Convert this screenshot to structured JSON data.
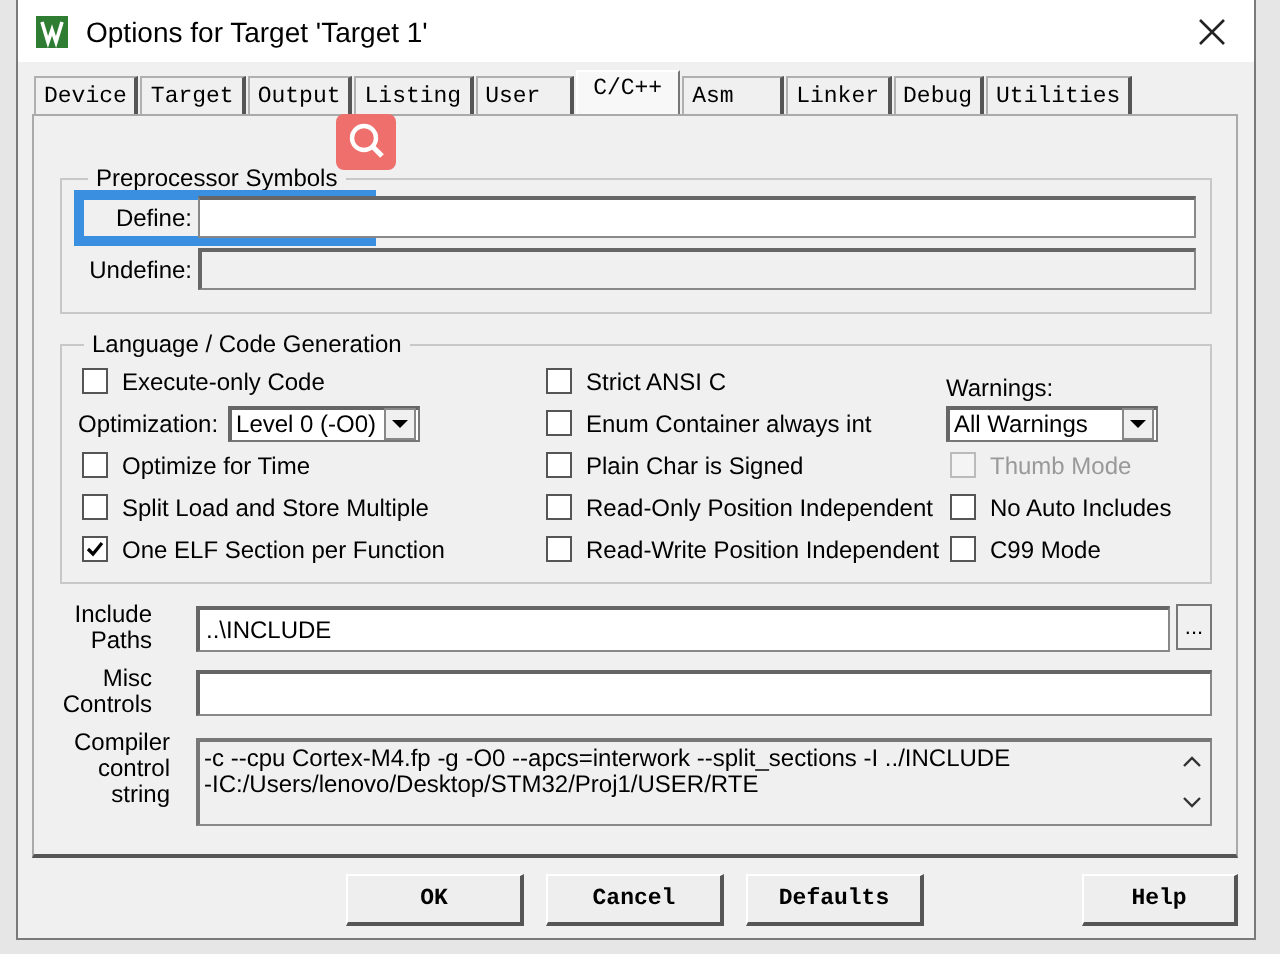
{
  "window": {
    "title": "Options for Target 'Target 1'"
  },
  "tabs": [
    {
      "label": "Device",
      "selected": false
    },
    {
      "label": "Target",
      "selected": false
    },
    {
      "label": "Output",
      "selected": false
    },
    {
      "label": "Listing",
      "selected": false
    },
    {
      "label": "User",
      "selected": false
    },
    {
      "label": "C/C++",
      "selected": true
    },
    {
      "label": "Asm",
      "selected": false
    },
    {
      "label": "Linker",
      "selected": false
    },
    {
      "label": "Debug",
      "selected": false
    },
    {
      "label": "Utilities",
      "selected": false
    }
  ],
  "preprocessor": {
    "title": "Preprocessor Symbols",
    "define": {
      "label": "Define:",
      "highlighted": true
    },
    "undefine": {
      "label": "Undefine:",
      "disabled": true
    }
  },
  "language": {
    "title": "Language / Code Generation",
    "columns": [
      [
        {
          "kind": "checkbox",
          "label": "Execute-only Code",
          "checked": false,
          "disabled": false
        },
        {
          "kind": "dropdown",
          "label": "Optimization:",
          "value": "Level 0 (-O0)"
        },
        {
          "kind": "checkbox",
          "label": "Optimize for Time",
          "checked": false,
          "disabled": false
        },
        {
          "kind": "checkbox",
          "label": "Split Load and Store Multiple",
          "checked": false,
          "disabled": false
        },
        {
          "kind": "checkbox",
          "label": "One ELF Section per Function",
          "checked": true,
          "disabled": false
        }
      ],
      [
        {
          "kind": "checkbox",
          "label": "Strict ANSI C",
          "checked": false,
          "disabled": false
        },
        {
          "kind": "checkbox",
          "label": "Enum Container always int",
          "checked": false,
          "disabled": false
        },
        {
          "kind": "checkbox",
          "label": "Plain Char is Signed",
          "checked": false,
          "disabled": false
        },
        {
          "kind": "checkbox",
          "label": "Read-Only Position Independent",
          "checked": false,
          "disabled": false
        },
        {
          "kind": "checkbox",
          "label": "Read-Write Position Independent",
          "checked": false,
          "disabled": false
        }
      ],
      [
        {
          "kind": "label",
          "label": "Warnings:"
        },
        {
          "kind": "dropdown",
          "value": "All Warnings"
        },
        {
          "kind": "checkbox",
          "label": "Thumb Mode",
          "checked": false,
          "disabled": true
        },
        {
          "kind": "checkbox",
          "label": "No Auto Includes",
          "checked": false,
          "disabled": false
        },
        {
          "kind": "checkbox",
          "label": "C99 Mode",
          "checked": false,
          "disabled": false
        }
      ]
    ]
  },
  "fields": [
    {
      "kind": "path",
      "label": "Include Paths",
      "value": "..\\INCLUDE",
      "button": "..."
    },
    {
      "kind": "text",
      "label": "Misc Controls"
    },
    {
      "kind": "multiline",
      "label": "Compiler control string",
      "value": "-c --cpu Cortex-M4.fp -g -O0 --apcs=interwork --split_sections -I ../INCLUDE\n-IC:/Users/lenovo/Desktop/STM32/Proj1/USER/RTE"
    }
  ],
  "buttons": [
    {
      "label": "OK",
      "kind": "left"
    },
    {
      "label": "Cancel",
      "kind": "left"
    },
    {
      "label": "Defaults",
      "kind": "left"
    },
    {
      "label": "Help",
      "kind": "right"
    }
  ]
}
